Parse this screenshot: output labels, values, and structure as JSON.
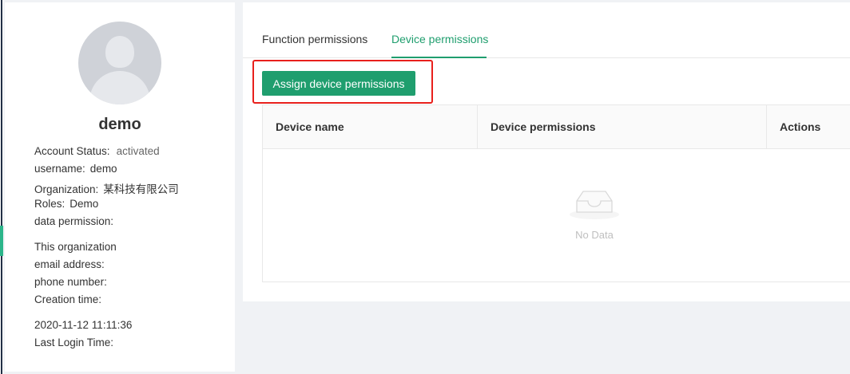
{
  "profile": {
    "name": "demo",
    "account_status_label": "Account Status:",
    "account_status_value": "activated",
    "username_label": "username:",
    "username_value": "demo",
    "organization_label": "Organization:",
    "organization_value": "某科技有限公司",
    "roles_label": "Roles:",
    "roles_value": "Demo",
    "data_permission_label": "data permission:",
    "data_permission_value": "This organization",
    "email_label": "email address:",
    "phone_label": "phone number:",
    "creation_time_label": "Creation time:",
    "creation_time_value": "2020-11-12 11:11:36",
    "last_login_label": "Last Login Time:"
  },
  "tabs": [
    {
      "label": "Function permissions",
      "active": false
    },
    {
      "label": "Device permissions",
      "active": true
    }
  ],
  "toolbar": {
    "assign_label": "Assign device permissions"
  },
  "table": {
    "columns": [
      "Device name",
      "Device permissions",
      "Actions"
    ],
    "rows": [],
    "empty_text": "No Data"
  },
  "colors": {
    "accent": "#1f9e6e",
    "highlight": "#e8201c",
    "sidebar_dark": "#223046"
  }
}
